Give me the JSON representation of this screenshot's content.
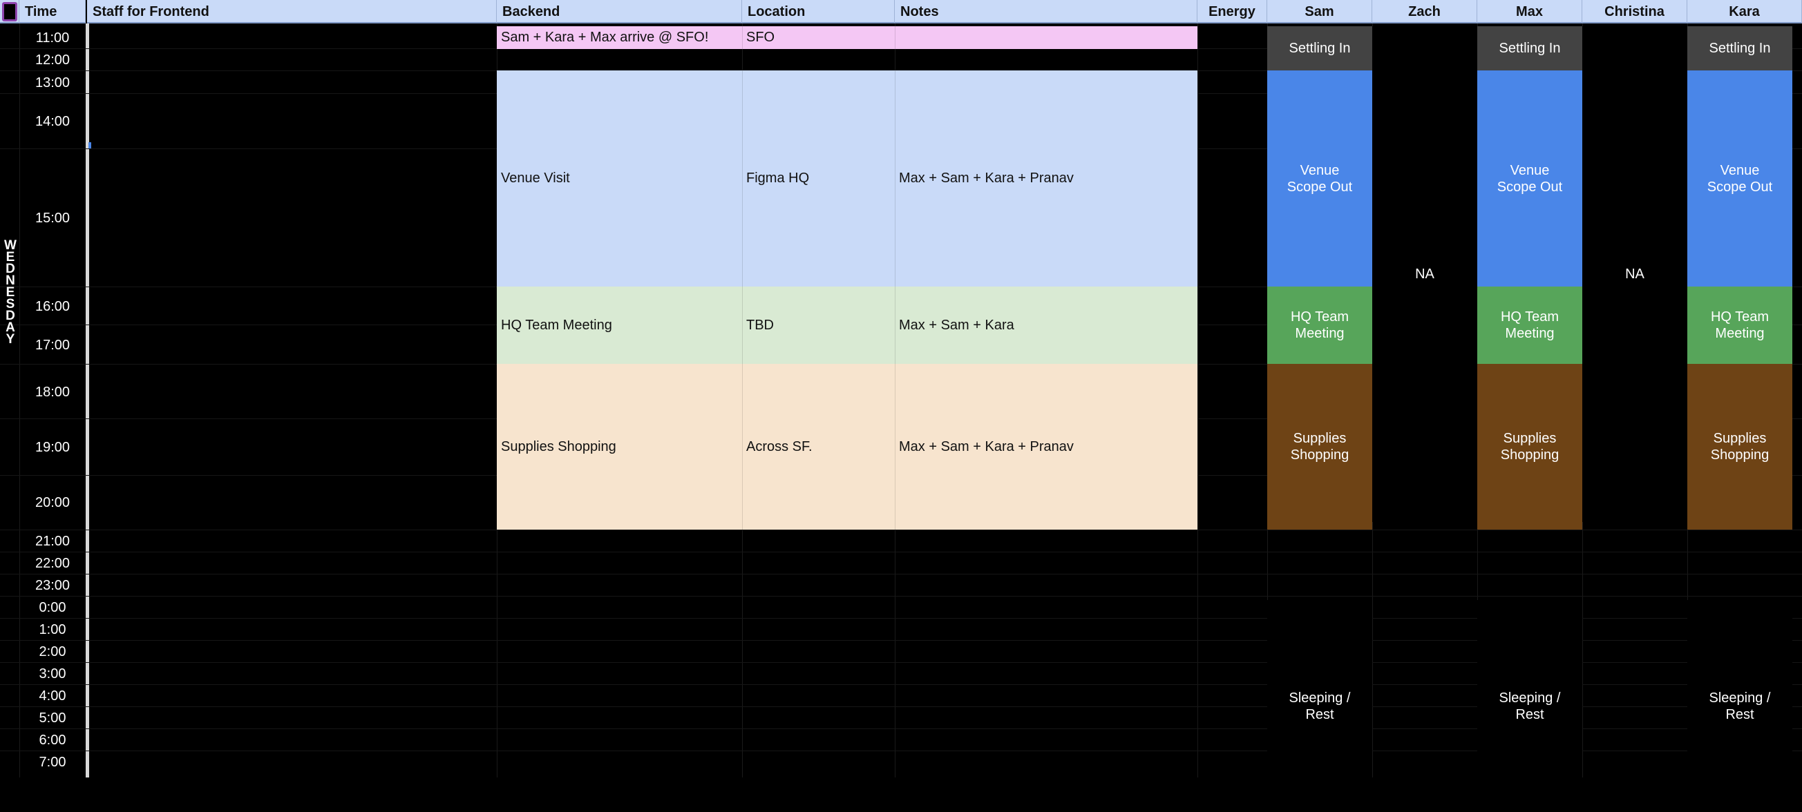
{
  "headers": {
    "time": "Time",
    "staff_frontend": "Staff for Frontend",
    "backend": "Backend",
    "location": "Location",
    "notes": "Notes",
    "energy": "Energy",
    "sam": "Sam",
    "zach": "Zach",
    "max": "Max",
    "christina": "Christina",
    "kara": "Kara"
  },
  "day_label": [
    "W",
    "E",
    "D",
    "N",
    "E",
    "S",
    "D",
    "A",
    "Y"
  ],
  "times": [
    "11:00",
    "12:00",
    "13:00",
    "14:00",
    "15:00",
    "16:00",
    "17:00",
    "18:00",
    "19:00",
    "20:00",
    "21:00",
    "22:00",
    "23:00",
    "0:00",
    "1:00",
    "2:00",
    "3:00",
    "4:00",
    "5:00",
    "6:00",
    "7:00"
  ],
  "events": [
    {
      "backend": "Sam + Kara + Max arrive @ SFO!",
      "location": "SFO",
      "notes": "",
      "color": "#f4c7f4"
    },
    {
      "backend": "Venue Visit",
      "location": "Figma HQ",
      "notes": "Max + Sam + Kara + Pranav",
      "color": "#c9daf8"
    },
    {
      "backend": "HQ Team Meeting",
      "location": "TBD",
      "notes": "Max + Sam + Kara",
      "color": "#d9ead3"
    },
    {
      "backend": "Supplies Shopping",
      "location": "Across SF.",
      "notes": "Max + Sam + Kara + Pranav",
      "color": "#f7e4ce"
    }
  ],
  "person_blocks": {
    "settling": {
      "label": "Settling In",
      "color": "#434343"
    },
    "venue": {
      "label": "Venue\nScope Out",
      "color": "#4a86e8"
    },
    "meeting": {
      "label": "HQ Team\nMeeting",
      "color": "#57a55a"
    },
    "shopping": {
      "label": "Supplies\nShopping",
      "color": "#6e4315"
    },
    "sleep": {
      "label": "Sleeping /\nRest",
      "color": "#000000"
    },
    "na": {
      "label": "NA",
      "color": "#000000"
    }
  }
}
